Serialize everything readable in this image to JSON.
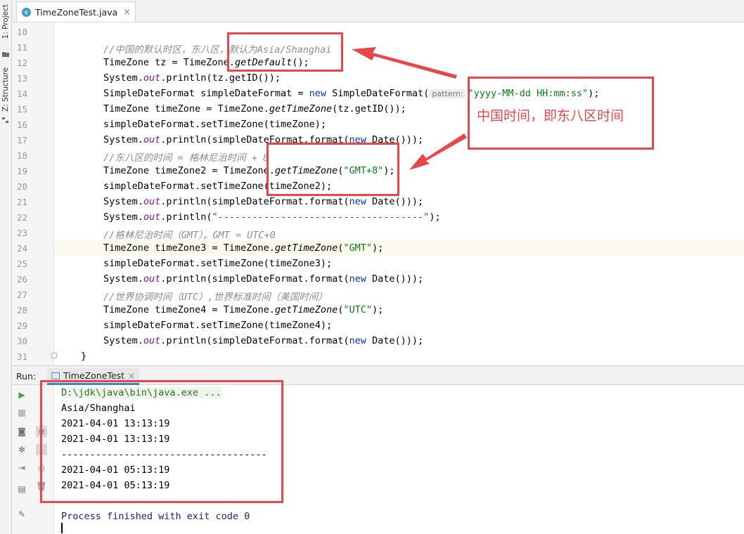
{
  "sidebar": {
    "project_label": "1: Project",
    "structure_label": "Z: Structure"
  },
  "editor": {
    "file_tab": "TimeZoneTest.java",
    "lines": [
      {
        "n": "10",
        "kind": "blank"
      },
      {
        "n": "11",
        "kind": "comment",
        "text": "//中国的默认时区，东八区，默认为Asia/Shanghai"
      },
      {
        "n": "12",
        "kind": "default",
        "a": "TimeZone tz = TimeZone.",
        "m": "getDefault",
        "b": "();"
      },
      {
        "n": "13",
        "kind": "println_id",
        "a": "System.",
        "f": "out",
        "b": ".println(tz.getID());"
      },
      {
        "n": "14",
        "kind": "sdf",
        "a": "SimpleDateFormat simpleDateFormat = ",
        "k": "new",
        "b": " SimpleDateFormat(",
        "hint": "pattern:",
        "s": "\"yyyy-MM-dd HH:mm:ss\"",
        "c": ");"
      },
      {
        "n": "15",
        "kind": "tz",
        "a": "TimeZone timeZone = TimeZone.",
        "m": "getTimeZone",
        "b": "(tz.getID());"
      },
      {
        "n": "16",
        "kind": "plain",
        "text": "simpleDateFormat.setTimeZone(timeZone);"
      },
      {
        "n": "17",
        "kind": "print_fmt",
        "a": "System.",
        "f": "out",
        "b": ".println(simpleDateFormat.format(",
        "k": "new",
        "c": " Date()));"
      },
      {
        "n": "18",
        "kind": "comment",
        "text": "//东八区的时间 = 格林尼治时间 + 8"
      },
      {
        "n": "19",
        "kind": "tzs",
        "a": "TimeZone timeZone2 = TimeZone.",
        "m": "getTimeZone",
        "b": "(",
        "s": "\"GMT+8\"",
        "c": ");"
      },
      {
        "n": "20",
        "kind": "plain",
        "text": "simpleDateFormat.setTimeZone(timeZone2);"
      },
      {
        "n": "21",
        "kind": "print_fmt",
        "a": "System.",
        "f": "out",
        "b": ".println(simpleDateFormat.format(",
        "k": "new",
        "c": " Date()));"
      },
      {
        "n": "22",
        "kind": "print_str",
        "a": "System.",
        "f": "out",
        "b": ".println(",
        "s": "\"------------------------------------\"",
        "c": ");"
      },
      {
        "n": "23",
        "kind": "comment",
        "text": "//格林尼治时间（GMT）。GMT = UTC+0"
      },
      {
        "n": "24",
        "kind": "tzs",
        "a": "TimeZone timeZone3 = TimeZone.",
        "m": "getTimeZone",
        "b": "(",
        "s": "\"GMT\"",
        "c": ");"
      },
      {
        "n": "25",
        "kind": "plain",
        "text": "simpleDateFormat.setTimeZone(timeZone3);"
      },
      {
        "n": "26",
        "kind": "print_fmt",
        "a": "System.",
        "f": "out",
        "b": ".println(simpleDateFormat.format(",
        "k": "new",
        "c": " Date()));"
      },
      {
        "n": "27",
        "kind": "comment",
        "text": "//世界协调时间（UTC）,世界标准时间（美国时间）"
      },
      {
        "n": "28",
        "kind": "tzs",
        "a": "TimeZone timeZone4 = TimeZone.",
        "m": "getTimeZone",
        "b": "(",
        "s": "\"UTC\"",
        "c": ");"
      },
      {
        "n": "29",
        "kind": "plain",
        "text": "simpleDateFormat.setTimeZone(timeZone4);"
      },
      {
        "n": "30",
        "kind": "print_fmt",
        "a": "System.",
        "f": "out",
        "b": ".println(simpleDateFormat.format(",
        "k": "new",
        "c": " Date()));"
      },
      {
        "n": "31",
        "kind": "closebrace",
        "text": "}"
      }
    ],
    "current_line": "24"
  },
  "run": {
    "label": "Run:",
    "tab": "TimeZoneTest",
    "output": [
      {
        "kind": "cmd",
        "text": "D:\\jdk\\java\\bin\\java.exe ..."
      },
      {
        "kind": "plain",
        "text": "Asia/Shanghai"
      },
      {
        "kind": "plain",
        "text": "2021-04-01 13:13:19"
      },
      {
        "kind": "plain",
        "text": "2021-04-01 13:13:19"
      },
      {
        "kind": "plain",
        "text": "------------------------------------"
      },
      {
        "kind": "plain",
        "text": "2021-04-01 05:13:19"
      },
      {
        "kind": "plain",
        "text": "2021-04-01 05:13:19"
      },
      {
        "kind": "blank",
        "text": ""
      },
      {
        "kind": "finish",
        "text": "Process finished with exit code 0"
      }
    ]
  },
  "annotation": {
    "note": "中国时间，即东八区时间",
    "color": "#e8474a"
  },
  "icons": [
    "folder-icon",
    "structure-icon",
    "java-class-icon",
    "close-icon",
    "run-icon",
    "stop-icon",
    "camera-icon",
    "settings-icon",
    "soft-wrap-icon",
    "scroll-to-end-icon",
    "import-icon",
    "print-icon",
    "trash-icon",
    "layout-icon",
    "pin-icon",
    "up-arrow-icon",
    "down-arrow-icon"
  ]
}
